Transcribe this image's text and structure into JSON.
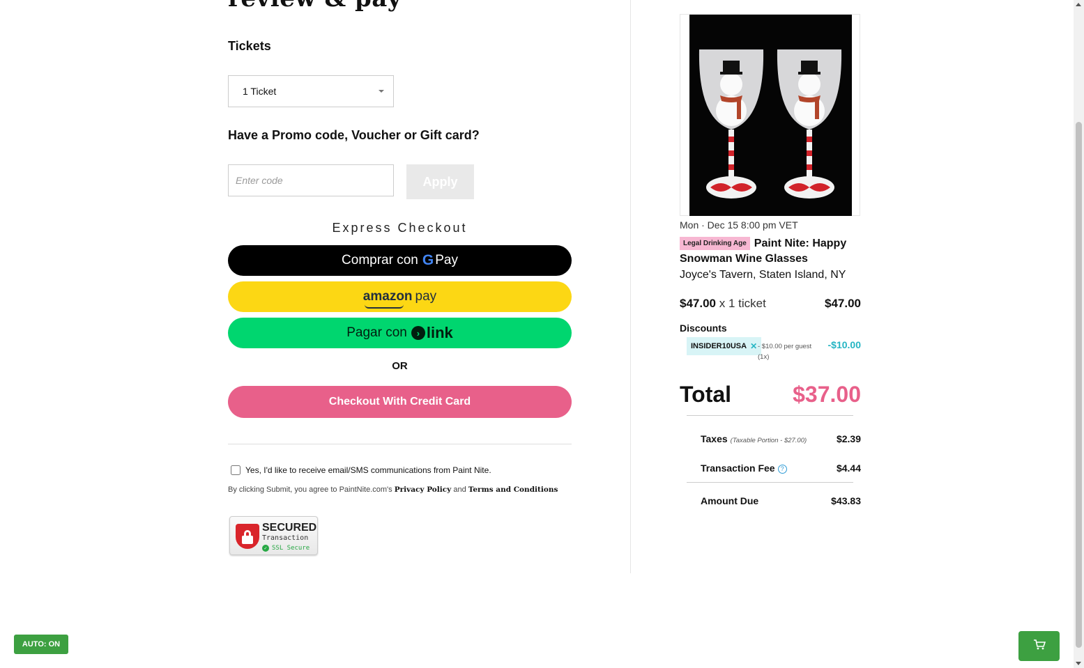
{
  "left": {
    "heading": "review & pay",
    "tickets_label": "Tickets",
    "ticket_select_value": "1 Ticket",
    "promo_label": "Have a Promo code, Voucher or Gift card?",
    "promo_placeholder": "Enter code",
    "apply_label": "Apply",
    "express_title": "Express Checkout",
    "gpay": {
      "prefix": "Comprar con",
      "g": "G",
      "pay": "Pay"
    },
    "amazon": {
      "amazon": "amazon",
      "pay": "pay"
    },
    "link": {
      "prefix": "Pagar con",
      "arrow": "›",
      "word": "link"
    },
    "or_text": "OR",
    "credit_card_label": "Checkout With Credit Card",
    "optin_label": "Yes, I'd like to receive email/SMS communications from Paint Nite.",
    "legal": {
      "prefix": "By clicking Submit, you agree to PaintNite.com's",
      "privacy": "Privacy Policy",
      "and": "and",
      "terms": "Terms and Conditions"
    },
    "ssl_badge": {
      "secured": "SECURED",
      "transaction": "Transaction",
      "ssl": "SSL Secure"
    }
  },
  "summary": {
    "date": "Mon · Dec 15 8:00 pm VET",
    "age_badge": "Legal Drinking Age",
    "title": "Paint Nite: Happy Snowman Wine Glasses",
    "venue": "Joyce's Tavern, Staten Island, NY",
    "unit_price": "$47.00",
    "qty_text": "x 1 ticket",
    "line_total": "$47.00",
    "discounts_label": "Discounts",
    "discount_code": "INSIDER10USA",
    "discount_note": "- $10.00 per guest (1x)",
    "discount_amount": "-$10.00",
    "total_label": "Total",
    "total_amount": "$37.00",
    "taxes_label": "Taxes",
    "taxes_note": "(Taxable Portion - $27.00)",
    "taxes_amount": "$2.39",
    "fee_label": "Transaction Fee",
    "fee_amount": "$4.44",
    "due_label": "Amount Due",
    "due_amount": "$43.83"
  },
  "footer": {
    "auto_badge": "AUTO: ON",
    "cart_icon": "cart-icon"
  },
  "colors": {
    "accent_pink": "#e8608a",
    "discount_teal": "#25b5c3",
    "green": "#3da041",
    "amazon_yellow": "#fcd714",
    "link_green": "#00d66f"
  }
}
